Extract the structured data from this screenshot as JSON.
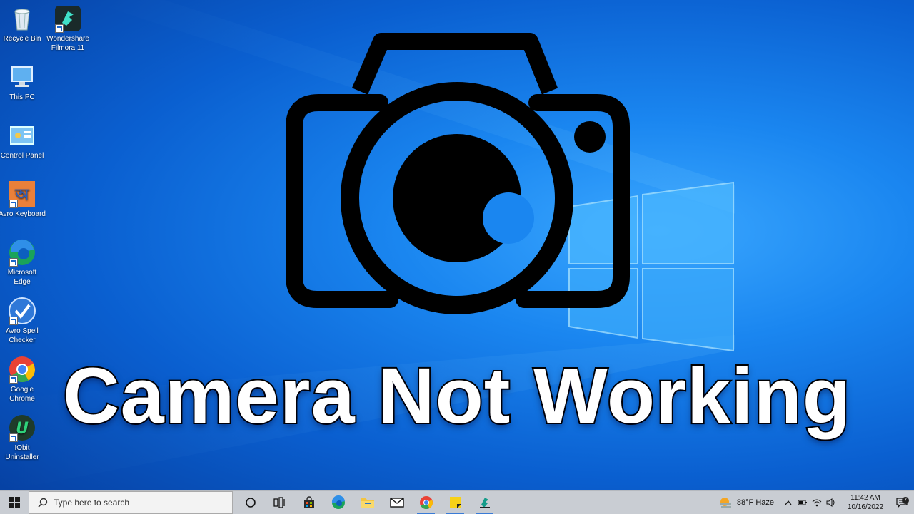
{
  "desktop": {
    "icons": [
      {
        "label": "Recycle Bin",
        "icon": "recycle-bin-icon"
      },
      {
        "label": "Wondershare Filmora 11",
        "icon": "filmora-icon"
      },
      {
        "label": "This PC",
        "icon": "computer-icon"
      },
      {
        "label": "Control Panel",
        "icon": "control-panel-icon"
      },
      {
        "label": "Avro Keyboard",
        "icon": "avro-keyboard-icon"
      },
      {
        "label": "Microsoft Edge",
        "icon": "edge-icon"
      },
      {
        "label": "Avro Spell Checker",
        "icon": "spell-checker-icon"
      },
      {
        "label": "Google Chrome",
        "icon": "chrome-icon"
      },
      {
        "label": "IObit Uninstaller",
        "icon": "iobit-uninstaller-icon"
      }
    ]
  },
  "overlay": {
    "headline": "Camera Not Working",
    "graphic": "camera-icon"
  },
  "taskbar": {
    "search_placeholder": "Type here to search",
    "pinned": [
      "cortana-icon",
      "task-view-icon",
      "store-icon",
      "edge-icon",
      "file-explorer-icon",
      "mail-icon",
      "chrome-icon",
      "sticky-notes-icon",
      "filmora-icon"
    ],
    "weather_text": "88°F  Haze",
    "time": "11:42 AM",
    "date": "10/16/2022",
    "notification_count": "7"
  },
  "colors": {
    "wallpaper": "#1a86f0",
    "taskbar": "#c9cdd3",
    "headline_fill": "#ffffff",
    "headline_stroke": "#000000"
  }
}
